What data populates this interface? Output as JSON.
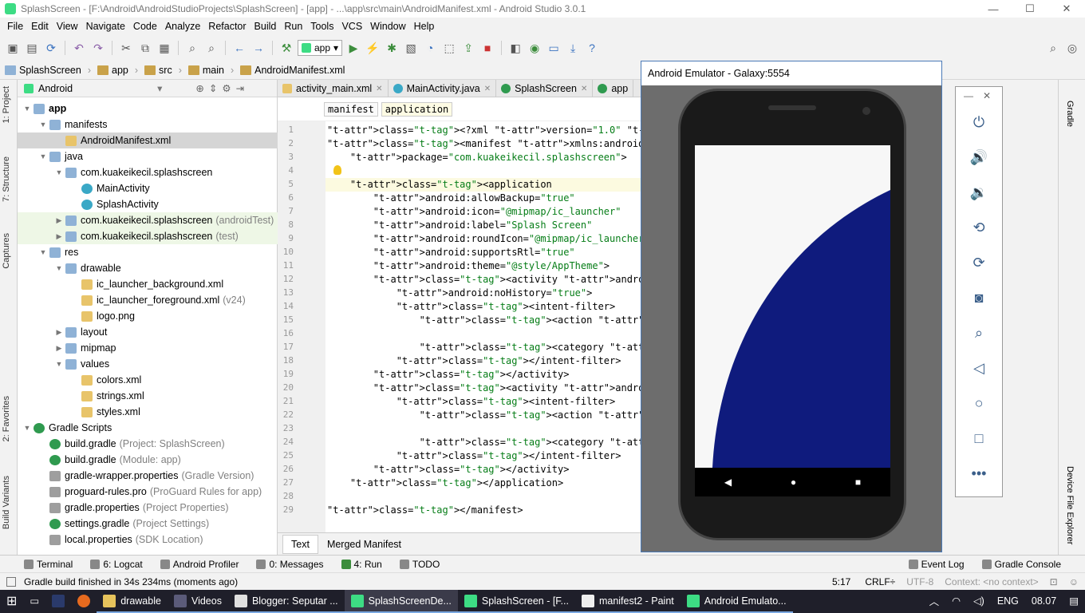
{
  "window": {
    "title": "SplashScreen - [F:\\Android\\AndroidStudioProjects\\SplashScreen] - [app] - ...\\app\\src\\main\\AndroidManifest.xml - Android Studio 3.0.1",
    "minimize": "—",
    "maximize": "☐",
    "close": "✕"
  },
  "menu": [
    "File",
    "Edit",
    "View",
    "Navigate",
    "Code",
    "Analyze",
    "Refactor",
    "Build",
    "Run",
    "Tools",
    "VCS",
    "Window",
    "Help"
  ],
  "toolbar": {
    "run_config": "app"
  },
  "breadcrumb": [
    "SplashScreen",
    "app",
    "src",
    "main",
    "AndroidManifest.xml"
  ],
  "left_tool_tabs": [
    "1: Project",
    "7: Structure",
    "Captures",
    "2: Favorites",
    "Build Variants"
  ],
  "project_panel": {
    "view_mode": "Android",
    "tree": [
      {
        "label": "app",
        "dim": "",
        "depth": 0,
        "toggle": "▼",
        "icon": "folder",
        "bold": true
      },
      {
        "label": "manifests",
        "dim": "",
        "depth": 1,
        "toggle": "▼",
        "icon": "folder"
      },
      {
        "label": "AndroidManifest.xml",
        "dim": "",
        "depth": 2,
        "toggle": "",
        "icon": "file",
        "selected": true
      },
      {
        "label": "java",
        "dim": "",
        "depth": 1,
        "toggle": "▼",
        "icon": "folder"
      },
      {
        "label": "com.kuakeikecil.splashscreen",
        "dim": "",
        "depth": 2,
        "toggle": "▼",
        "icon": "folder"
      },
      {
        "label": "MainActivity",
        "dim": "",
        "depth": 3,
        "toggle": "",
        "icon": "cls"
      },
      {
        "label": "SplashActivity",
        "dim": "",
        "depth": 3,
        "toggle": "",
        "icon": "cls"
      },
      {
        "label": "com.kuakeikecil.splashscreen",
        "dim": "(androidTest)",
        "depth": 2,
        "toggle": "▶",
        "icon": "folder",
        "test": true
      },
      {
        "label": "com.kuakeikecil.splashscreen",
        "dim": "(test)",
        "depth": 2,
        "toggle": "▶",
        "icon": "folder",
        "test": true
      },
      {
        "label": "res",
        "dim": "",
        "depth": 1,
        "toggle": "▼",
        "icon": "folder"
      },
      {
        "label": "drawable",
        "dim": "",
        "depth": 2,
        "toggle": "▼",
        "icon": "folder"
      },
      {
        "label": "ic_launcher_background.xml",
        "dim": "",
        "depth": 3,
        "toggle": "",
        "icon": "file"
      },
      {
        "label": "ic_launcher_foreground.xml",
        "dim": "(v24)",
        "depth": 3,
        "toggle": "",
        "icon": "file"
      },
      {
        "label": "logo.png",
        "dim": "",
        "depth": 3,
        "toggle": "",
        "icon": "file"
      },
      {
        "label": "layout",
        "dim": "",
        "depth": 2,
        "toggle": "▶",
        "icon": "folder"
      },
      {
        "label": "mipmap",
        "dim": "",
        "depth": 2,
        "toggle": "▶",
        "icon": "folder"
      },
      {
        "label": "values",
        "dim": "",
        "depth": 2,
        "toggle": "▼",
        "icon": "folder"
      },
      {
        "label": "colors.xml",
        "dim": "",
        "depth": 3,
        "toggle": "",
        "icon": "file"
      },
      {
        "label": "strings.xml",
        "dim": "",
        "depth": 3,
        "toggle": "",
        "icon": "file"
      },
      {
        "label": "styles.xml",
        "dim": "",
        "depth": 3,
        "toggle": "",
        "icon": "file"
      },
      {
        "label": "Gradle Scripts",
        "dim": "",
        "depth": 0,
        "toggle": "▼",
        "icon": "grad"
      },
      {
        "label": "build.gradle",
        "dim": "(Project: SplashScreen)",
        "depth": 1,
        "toggle": "",
        "icon": "grad"
      },
      {
        "label": "build.gradle",
        "dim": "(Module: app)",
        "depth": 1,
        "toggle": "",
        "icon": "grad"
      },
      {
        "label": "gradle-wrapper.properties",
        "dim": "(Gradle Version)",
        "depth": 1,
        "toggle": "",
        "icon": "prop"
      },
      {
        "label": "proguard-rules.pro",
        "dim": "(ProGuard Rules for app)",
        "depth": 1,
        "toggle": "",
        "icon": "prop"
      },
      {
        "label": "gradle.properties",
        "dim": "(Project Properties)",
        "depth": 1,
        "toggle": "",
        "icon": "prop"
      },
      {
        "label": "settings.gradle",
        "dim": "(Project Settings)",
        "depth": 1,
        "toggle": "",
        "icon": "grad"
      },
      {
        "label": "local.properties",
        "dim": "(SDK Location)",
        "depth": 1,
        "toggle": "",
        "icon": "prop"
      }
    ]
  },
  "editor_tabs": [
    "activity_main.xml",
    "MainActivity.java",
    "SplashScreen",
    "app"
  ],
  "editor_breadcrumb": [
    "manifest",
    "application"
  ],
  "code_lines": [
    {
      "n": "1",
      "t": "<?xml version=\"1.0\" encoding=\"utf-8\"?>"
    },
    {
      "n": "2",
      "t": "<manifest xmlns:android=\"http://schemas.android.com/apk/"
    },
    {
      "n": "3",
      "t": "    package=\"com.kuakeikecil.splashscreen\">"
    },
    {
      "n": "4",
      "t": ""
    },
    {
      "n": "5",
      "t": "    <application"
    },
    {
      "n": "6",
      "t": "        android:allowBackup=\"true\""
    },
    {
      "n": "7",
      "t": "        android:icon=\"@mipmap/ic_launcher\""
    },
    {
      "n": "8",
      "t": "        android:label=\"Splash Screen\""
    },
    {
      "n": "9",
      "t": "        android:roundIcon=\"@mipmap/ic_launcher_round\""
    },
    {
      "n": "10",
      "t": "        android:supportsRtl=\"true\""
    },
    {
      "n": "11",
      "t": "        android:theme=\"@style/AppTheme\">"
    },
    {
      "n": "12",
      "t": "        <activity android:name=\".SplashActivity\""
    },
    {
      "n": "13",
      "t": "            android:noHistory=\"true\">"
    },
    {
      "n": "14",
      "t": "            <intent-filter>"
    },
    {
      "n": "15",
      "t": "                <action android:name=\"android.intent.act"
    },
    {
      "n": "16",
      "t": ""
    },
    {
      "n": "17",
      "t": "                <category android:name=\"android.intent.c"
    },
    {
      "n": "18",
      "t": "            </intent-filter>"
    },
    {
      "n": "19",
      "t": "        </activity>"
    },
    {
      "n": "20",
      "t": "        <activity android:name=\".MainActivity\">"
    },
    {
      "n": "21",
      "t": "            <intent-filter>"
    },
    {
      "n": "22",
      "t": "                <action android:name=\"android.intent.act"
    },
    {
      "n": "23",
      "t": ""
    },
    {
      "n": "24",
      "t": "                <category android:name=\"android.intent.c"
    },
    {
      "n": "25",
      "t": "            </intent-filter>"
    },
    {
      "n": "26",
      "t": "        </activity>"
    },
    {
      "n": "27",
      "t": "    </application>"
    },
    {
      "n": "28",
      "t": ""
    },
    {
      "n": "29",
      "t": "</manifest>"
    }
  ],
  "editor_bottom_tabs": [
    "Text",
    "Merged Manifest"
  ],
  "emulator": {
    "title": "Android Emulator - Galaxy:5554"
  },
  "emulator_controls": [
    "power-icon",
    "volume-up-icon",
    "volume-down-icon",
    "rotate-left-icon",
    "rotate-right-icon",
    "camera-icon",
    "zoom-icon",
    "back-icon",
    "home-icon",
    "overview-icon",
    "more-icon"
  ],
  "right_tool_tabs": [
    "Gradle",
    "Device File Explorer"
  ],
  "tool_windows": [
    {
      "label": "Terminal"
    },
    {
      "label": "6: Logcat"
    },
    {
      "label": "Android Profiler"
    },
    {
      "label": "0: Messages"
    },
    {
      "label": "4: Run"
    },
    {
      "label": "TODO"
    }
  ],
  "tool_windows_right": [
    {
      "label": "Event Log"
    },
    {
      "label": "Gradle Console"
    }
  ],
  "status": {
    "message": "Gradle build finished in 34s 234ms (moments ago)",
    "position": "5:17",
    "line_sep": "CRLF÷",
    "encoding": "UTF-8",
    "context": "Context: <no context>"
  },
  "taskbar": {
    "items": [
      {
        "label": "drawable",
        "color": "#e6c35c"
      },
      {
        "label": "Videos",
        "color": "#5b5b7a"
      },
      {
        "label": "Blogger: Seputar ...",
        "color": "#e0e0e0"
      },
      {
        "label": "SplashScreenDe...",
        "color": "#3ddc84",
        "active": true
      },
      {
        "label": "SplashScreen - [F...",
        "color": "#3ddc84"
      },
      {
        "label": "manifest2 - Paint",
        "color": "#eeeeee"
      },
      {
        "label": "Android Emulato...",
        "color": "#3ddc84"
      }
    ],
    "lang": "ENG",
    "time": "08.07"
  },
  "colors": {
    "accent": "#3b73c0",
    "emulator_arc": "#0f1b7d"
  }
}
